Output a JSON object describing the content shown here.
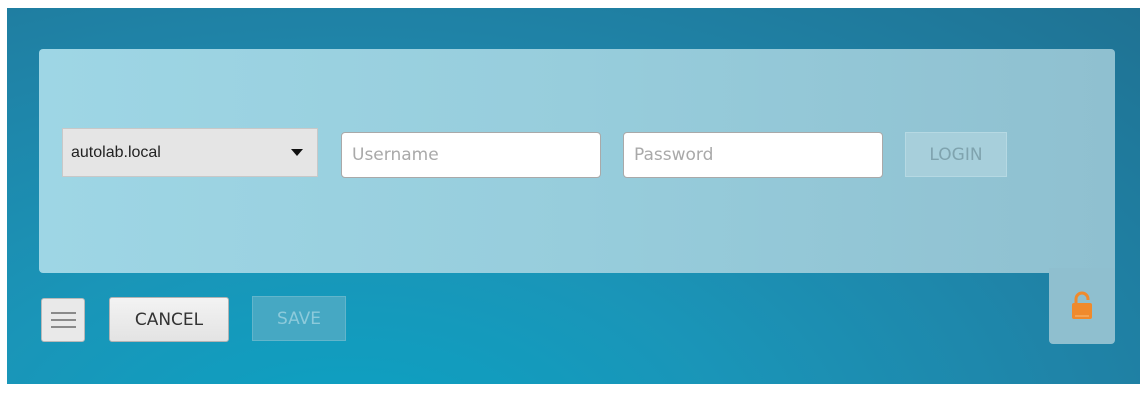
{
  "login_form": {
    "domain_select": {
      "selected": "autolab.local"
    },
    "username": {
      "placeholder": "Username",
      "value": ""
    },
    "password": {
      "placeholder": "Password",
      "value": ""
    },
    "login_label": "LOGIN"
  },
  "toolbar": {
    "menu_icon": "hamburger-menu-icon",
    "cancel_label": "CANCEL",
    "save_label": "SAVE"
  },
  "lock": {
    "icon": "unlocked-padlock-icon",
    "color": "#f08a2c"
  },
  "colors": {
    "background_accent": "#1a95b8",
    "panel": "#9ed6e5"
  }
}
